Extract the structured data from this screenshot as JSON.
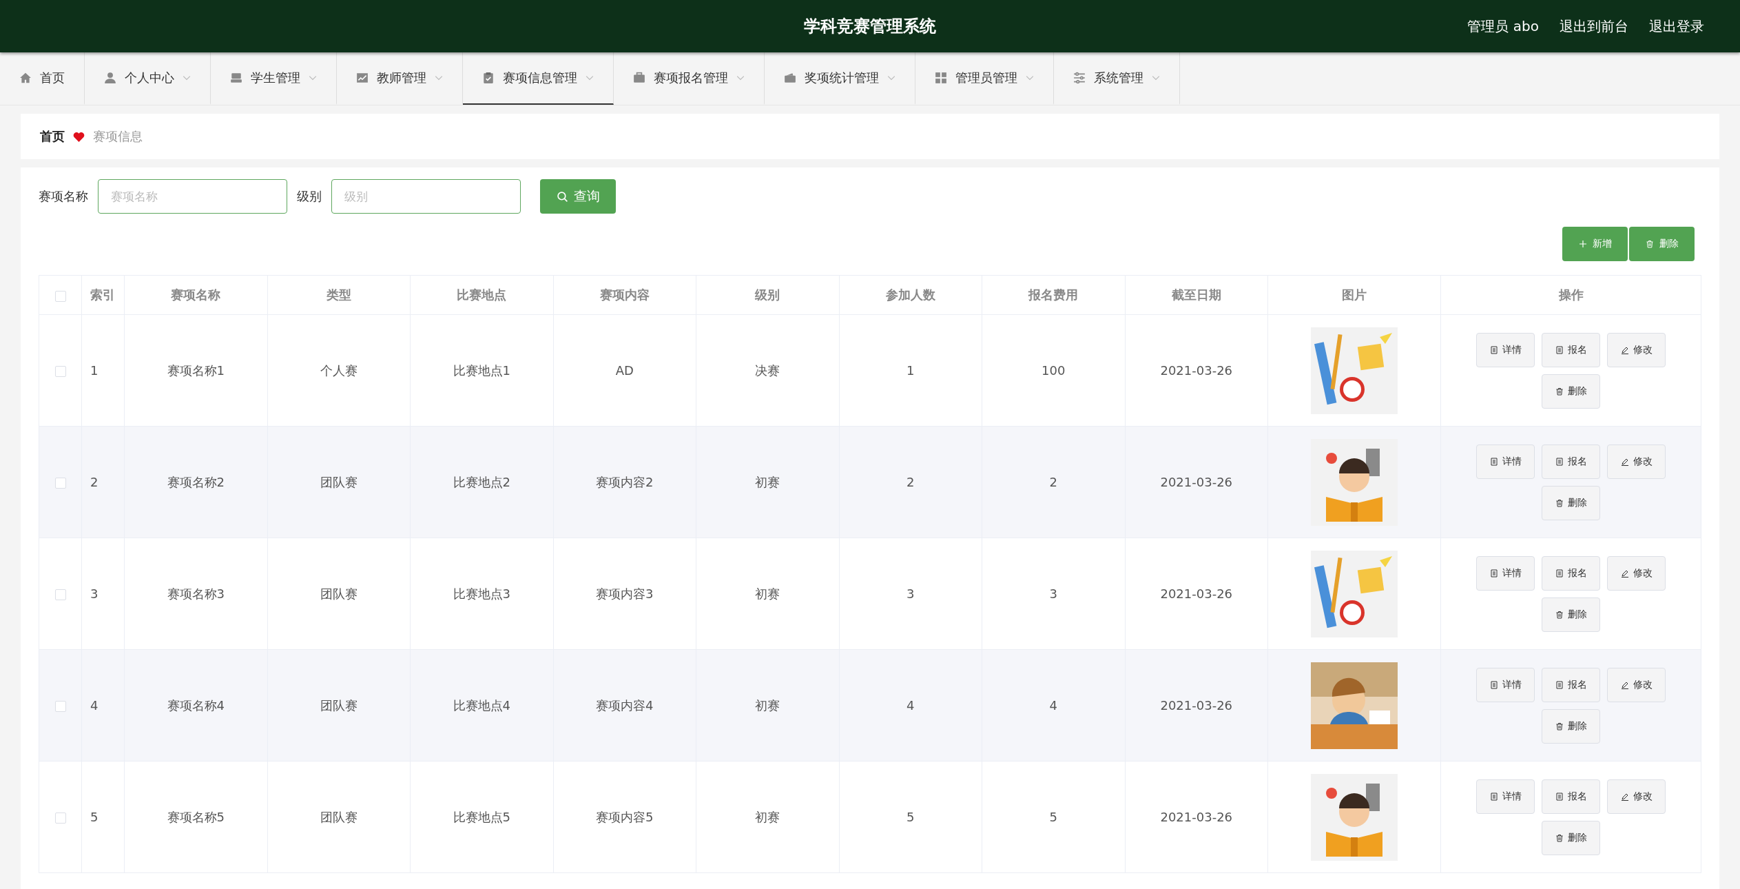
{
  "header": {
    "title": "学科竞赛管理系统",
    "links": [
      "管理员 abo",
      "退出到前台",
      "退出登录"
    ]
  },
  "nav": [
    {
      "label": "首页",
      "selected": false,
      "dropdown": false
    },
    {
      "label": "个人中心",
      "selected": false,
      "dropdown": true
    },
    {
      "label": "学生管理",
      "selected": false,
      "dropdown": true
    },
    {
      "label": "教师管理",
      "selected": false,
      "dropdown": true
    },
    {
      "label": "赛项信息管理",
      "selected": true,
      "dropdown": true
    },
    {
      "label": "赛项报名管理",
      "selected": false,
      "dropdown": true
    },
    {
      "label": "奖项统计管理",
      "selected": false,
      "dropdown": true
    },
    {
      "label": "管理员管理",
      "selected": false,
      "dropdown": true
    },
    {
      "label": "系统管理",
      "selected": false,
      "dropdown": true
    }
  ],
  "breadcrumb": [
    "首页",
    "赛项信息"
  ],
  "search": {
    "fields": [
      {
        "label": "赛项名称",
        "placeholder": "赛项名称"
      },
      {
        "label": "级别",
        "placeholder": "级别"
      }
    ],
    "button": "查询"
  },
  "toolbar": [
    {
      "kind": "add",
      "label": "新增"
    },
    {
      "kind": "delete",
      "label": "删除"
    }
  ],
  "table": {
    "header_checked": false,
    "columns": [
      "索引",
      "赛项名称",
      "类型",
      "比赛地点",
      "赛项内容",
      "级别",
      "参加人数",
      "报名费用",
      "截至日期",
      "图片",
      "操作"
    ],
    "rows": [
      {
        "checked": false,
        "cells": [
          "1",
          "赛项名称1",
          "个人赛",
          "比赛地点1",
          "AD",
          "决赛",
          "1",
          "100",
          "2021-03-26"
        ],
        "actions": [
          {
            "kind": "detail",
            "label": "详情"
          },
          {
            "kind": "signup",
            "label": "报名"
          },
          {
            "kind": "edit",
            "label": "修改"
          },
          {
            "kind": "delete",
            "label": "删除"
          }
        ]
      },
      {
        "checked": false,
        "cells": [
          "2",
          "赛项名称2",
          "团队赛",
          "比赛地点2",
          "赛项内容2",
          "初赛",
          "2",
          "2",
          "2021-03-26"
        ],
        "actions": [
          {
            "kind": "detail",
            "label": "详情"
          },
          {
            "kind": "signup",
            "label": "报名"
          },
          {
            "kind": "edit",
            "label": "修改"
          },
          {
            "kind": "delete",
            "label": "删除"
          }
        ]
      },
      {
        "checked": false,
        "cells": [
          "3",
          "赛项名称3",
          "团队赛",
          "比赛地点3",
          "赛项内容3",
          "初赛",
          "3",
          "3",
          "2021-03-26"
        ],
        "actions": [
          {
            "kind": "detail",
            "label": "详情"
          },
          {
            "kind": "signup",
            "label": "报名"
          },
          {
            "kind": "edit",
            "label": "修改"
          },
          {
            "kind": "delete",
            "label": "删除"
          }
        ]
      },
      {
        "checked": false,
        "cells": [
          "4",
          "赛项名称4",
          "团队赛",
          "比赛地点4",
          "赛项内容4",
          "初赛",
          "4",
          "4",
          "2021-03-26"
        ],
        "actions": [
          {
            "kind": "detail",
            "label": "详情"
          },
          {
            "kind": "signup",
            "label": "报名"
          },
          {
            "kind": "edit",
            "label": "修改"
          },
          {
            "kind": "delete",
            "label": "删除"
          }
        ]
      },
      {
        "checked": false,
        "cells": [
          "5",
          "赛项名称5",
          "团队赛",
          "比赛地点5",
          "赛项内容5",
          "初赛",
          "5",
          "5",
          "2021-03-26"
        ],
        "actions": [
          {
            "kind": "detail",
            "label": "详情"
          },
          {
            "kind": "signup",
            "label": "报名"
          },
          {
            "kind": "edit",
            "label": "修改"
          },
          {
            "kind": "delete",
            "label": "删除"
          }
        ]
      }
    ]
  }
}
